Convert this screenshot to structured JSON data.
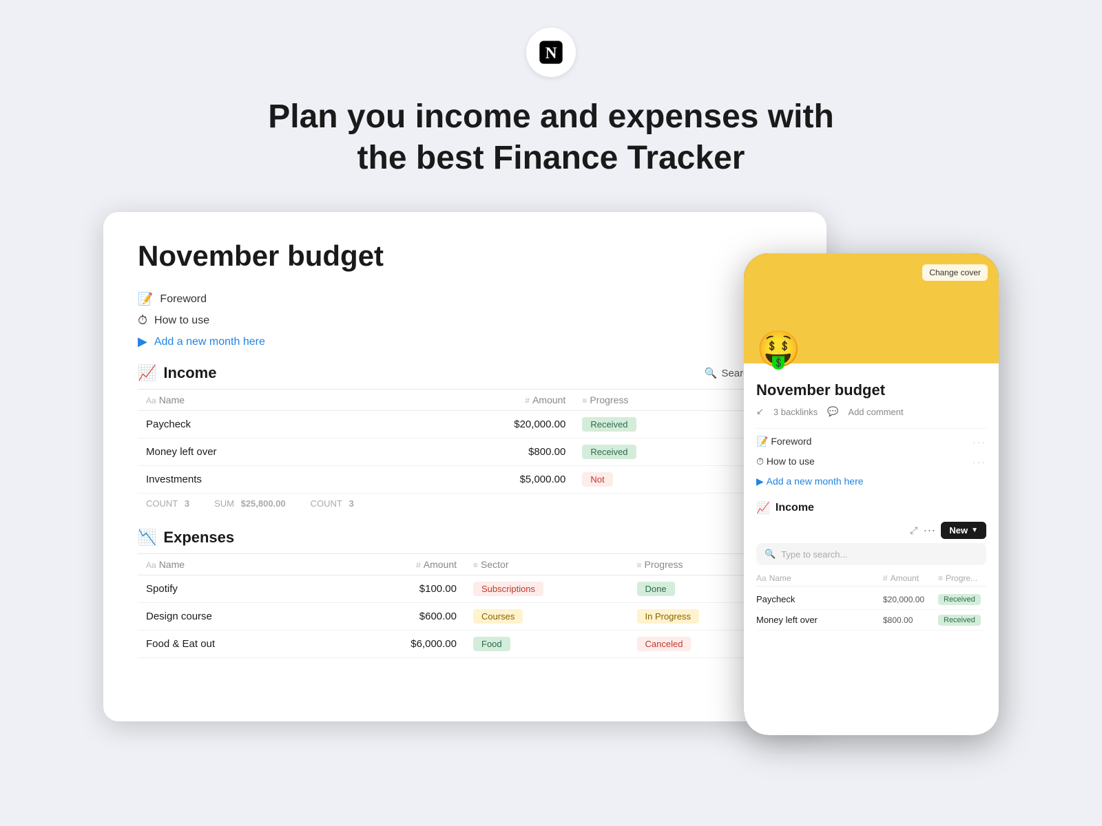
{
  "logo": {
    "alt": "Notion logo"
  },
  "hero": {
    "title_line1": "Plan you income and expenses with",
    "title_line2": "the best Finance Tracker"
  },
  "desktop": {
    "page_title": "November budget",
    "nav": [
      {
        "id": "foreword",
        "icon": "📝",
        "label": "Foreword",
        "type": "normal"
      },
      {
        "id": "how-to-use",
        "icon": "⏱",
        "label": "How to use",
        "type": "normal"
      },
      {
        "id": "add-month",
        "icon": "▶",
        "label": "Add a new month here",
        "type": "link"
      }
    ],
    "income": {
      "section_icon": "📈",
      "section_title": "Income",
      "search_label": "Search",
      "columns": [
        {
          "icon": "Aa",
          "label": "Name"
        },
        {
          "icon": "#",
          "label": "Amount"
        },
        {
          "icon": "≡",
          "label": "Progress"
        }
      ],
      "rows": [
        {
          "name": "Paycheck",
          "amount": "$20,000.00",
          "progress": "Received",
          "progress_type": "received"
        },
        {
          "name": "Money left over",
          "amount": "$800.00",
          "progress": "Received",
          "progress_type": "received"
        },
        {
          "name": "Investments",
          "amount": "$5,000.00",
          "progress": "Not",
          "progress_type": "not"
        }
      ],
      "footer": {
        "count_label": "COUNT",
        "count_value": "3",
        "sum_label": "SUM",
        "sum_value": "$25,800.00",
        "count2_label": "COUNT",
        "count2_value": "3"
      }
    },
    "expenses": {
      "section_icon": "📉",
      "section_title": "Expenses",
      "columns": [
        {
          "icon": "Aa",
          "label": "Name"
        },
        {
          "icon": "#",
          "label": "Amount"
        },
        {
          "icon": "≡",
          "label": "Sector"
        },
        {
          "icon": "≡",
          "label": "Progress"
        }
      ],
      "rows": [
        {
          "name": "Spotify",
          "amount": "$100.00",
          "sector": "Subscriptions",
          "sector_type": "subscriptions",
          "progress": "Done",
          "progress_type": "done"
        },
        {
          "name": "Design course",
          "amount": "$600.00",
          "sector": "Courses",
          "sector_type": "courses",
          "progress": "In Progress",
          "progress_type": "inprogress"
        },
        {
          "name": "Food & Eat out",
          "amount": "$6,000.00",
          "sector": "Food",
          "sector_type": "food",
          "progress": "Canceled",
          "progress_type": "canceled"
        }
      ]
    }
  },
  "mobile": {
    "header_bg": "#f5c842",
    "emoji": "🤑",
    "change_cover_label": "Change cover",
    "page_title": "November budget",
    "backlinks": "3 backlinks",
    "add_comment": "Add comment",
    "nav": [
      {
        "label": "Foreword",
        "icon": "📝"
      },
      {
        "label": "How to use",
        "icon": "⏱"
      },
      {
        "label": "Add a new month here",
        "icon": "▶",
        "type": "link"
      }
    ],
    "income_section": "Income",
    "income_icon": "📈",
    "new_btn_label": "New",
    "search_placeholder": "Type to search...",
    "table_headers": [
      {
        "icon": "Aa",
        "label": "Name"
      },
      {
        "icon": "#",
        "label": "Amount"
      },
      {
        "icon": "≡",
        "label": "Progre..."
      }
    ],
    "table_rows": [
      {
        "name": "Paycheck",
        "amount": "$20,000.00",
        "badge": "Received",
        "badge_type": "received"
      },
      {
        "name": "Money left over",
        "amount": "$800.00",
        "badge": "Received",
        "badge_type": "received"
      }
    ]
  },
  "badges": {
    "received_bg": "#d4edda",
    "received_color": "#2d6a4f",
    "not_bg": "#fdecea",
    "not_color": "#c0392b",
    "done_bg": "#d4edda",
    "done_color": "#2d6a4f",
    "inprogress_bg": "#fff3cd",
    "inprogress_color": "#856404",
    "canceled_bg": "#fdecea",
    "canceled_color": "#c0392b"
  }
}
